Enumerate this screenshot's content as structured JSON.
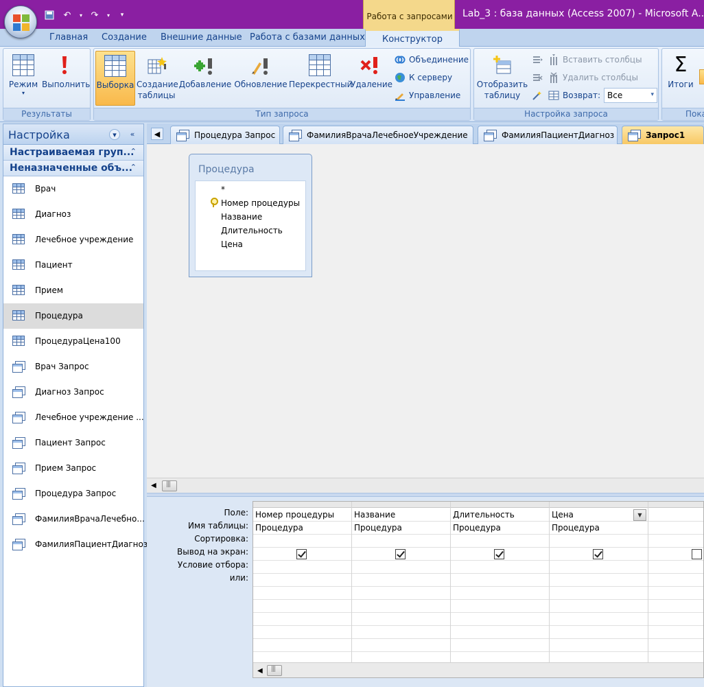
{
  "window": {
    "title": "Lab_3 : база данных (Access 2007)  -  Microsoft A...",
    "context_tab": "Работа с запросами"
  },
  "ribbon_tabs": [
    "Главная",
    "Создание",
    "Внешние данные",
    "Работа с базами данных",
    "Конструктор"
  ],
  "ribbon": {
    "results": {
      "label": "Результаты",
      "mode": "Режим",
      "run": "Выполнить"
    },
    "query_type": {
      "label": "Тип запроса",
      "select": "Выборка",
      "make_table_1": "Создание",
      "make_table_2": "таблицы",
      "append": "Добавление",
      "update": "Обновление",
      "crosstab": "Перекрестный",
      "delete": "Удаление",
      "union": "Объединение",
      "pass_through": "К серверу",
      "data_definition": "Управление"
    },
    "query_setup": {
      "label": "Настройка запроса",
      "show_table_1": "Отобразить",
      "show_table_2": "таблицу",
      "insert_columns": "Вставить столбцы",
      "delete_columns": "Удалить столбцы",
      "return_label": "Возврат:",
      "return_value": "Все"
    },
    "totals": "Итоги",
    "show_hide_label": "Пока"
  },
  "nav": {
    "title": "Настройка",
    "groups": [
      "Настраиваемая груп...",
      "Неназначенные объ..."
    ],
    "items": [
      {
        "label": "Врач",
        "type": "table"
      },
      {
        "label": "Диагноз",
        "type": "table"
      },
      {
        "label": "Лечебное учреждение",
        "type": "table"
      },
      {
        "label": "Пациент",
        "type": "table"
      },
      {
        "label": "Прием",
        "type": "table"
      },
      {
        "label": "Процедура",
        "type": "table",
        "selected": true
      },
      {
        "label": "ПроцедураЦена100",
        "type": "table"
      },
      {
        "label": "Врач Запрос",
        "type": "query"
      },
      {
        "label": "Диагноз Запрос",
        "type": "query"
      },
      {
        "label": "Лечебное учреждение ...",
        "type": "query"
      },
      {
        "label": "Пациент Запрос",
        "type": "query"
      },
      {
        "label": "Прием Запрос",
        "type": "query"
      },
      {
        "label": "Процедура Запрос",
        "type": "query"
      },
      {
        "label": "ФамилияВрачаЛечебно...",
        "type": "query"
      },
      {
        "label": "ФамилияПациентДиагноз",
        "type": "query"
      }
    ]
  },
  "doc_tabs": [
    {
      "label": "Процедура Запрос",
      "active": false
    },
    {
      "label": "ФамилияВрачаЛечебноеУчреждение",
      "active": false
    },
    {
      "label": "ФамилияПациентДиагноз",
      "active": false
    },
    {
      "label": "Запрос1",
      "active": true
    }
  ],
  "field_list": {
    "title": "Процедура",
    "fields": [
      "*",
      "Номер процедуры",
      "Название",
      "Длительность",
      "Цена"
    ]
  },
  "design_grid": {
    "row_labels": [
      "Поле:",
      "Имя таблицы:",
      "Сортировка:",
      "Вывод на экран:",
      "Условие отбора:",
      "или:"
    ],
    "columns": [
      {
        "field": "Номер процедуры",
        "table": "Процедура",
        "show": true
      },
      {
        "field": "Название",
        "table": "Процедура",
        "show": true
      },
      {
        "field": "Длительность",
        "table": "Процедура",
        "show": true
      },
      {
        "field": "Цена",
        "table": "Процедура",
        "show": true
      },
      {
        "field": "",
        "table": "",
        "show": false
      }
    ]
  }
}
